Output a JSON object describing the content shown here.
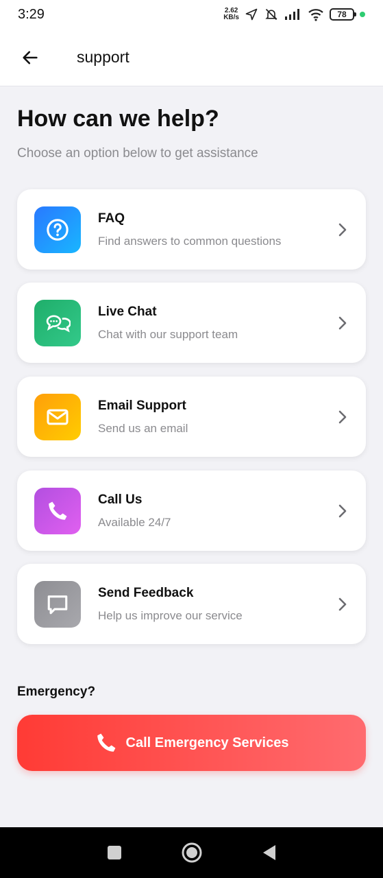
{
  "status_bar": {
    "time": "3:29",
    "net_speed_value": "2.62",
    "net_speed_unit": "KB/s",
    "battery": "78"
  },
  "app_bar": {
    "title": "support"
  },
  "main": {
    "heading": "How can we help?",
    "subheading": "Choose an option below to get assistance",
    "options": [
      {
        "title": "FAQ",
        "subtitle": "Find answers to common questions",
        "icon": "question-icon",
        "colors": [
          "#2979ff",
          "#19b6ff"
        ]
      },
      {
        "title": "Live Chat",
        "subtitle": "Chat with our support team",
        "icon": "chat-bubbles-icon",
        "colors": [
          "#1fae6a",
          "#33c98a"
        ]
      },
      {
        "title": "Email Support",
        "subtitle": "Send us an email",
        "icon": "envelope-icon",
        "colors": [
          "#ff9f0a",
          "#ffcc00"
        ]
      },
      {
        "title": "Call Us",
        "subtitle": "Available 24/7",
        "icon": "phone-icon",
        "colors": [
          "#b34fe0",
          "#e060f0"
        ]
      },
      {
        "title": "Send Feedback",
        "subtitle": "Help us improve our service",
        "icon": "feedback-icon",
        "colors": [
          "#8e8e93",
          "#a8a8ad"
        ]
      }
    ],
    "emergency_label": "Emergency?",
    "emergency_button": "Call Emergency Services"
  },
  "colors": {
    "emergency_start": "#ff3b35",
    "emergency_end": "#ff6b6f",
    "background": "#f2f2f6"
  }
}
